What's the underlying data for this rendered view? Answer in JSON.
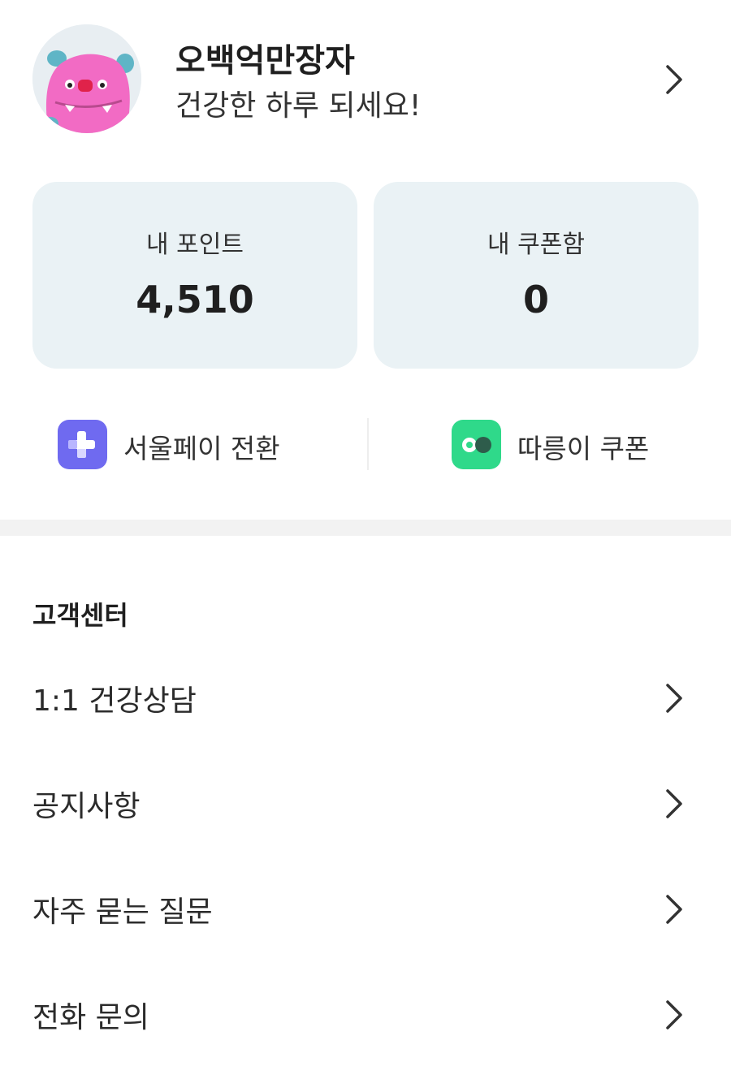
{
  "profile": {
    "nickname": "오백억만장자",
    "greeting": "건강한 하루 되세요!",
    "avatar_icon": "pink-monster-avatar"
  },
  "cards": {
    "points": {
      "label": "내 포인트",
      "value": "4,510"
    },
    "coupons": {
      "label": "내 쿠폰함",
      "value": "0"
    }
  },
  "quick_actions": [
    {
      "label": "서울페이 전환",
      "icon": "seoulpay-plus-icon",
      "color": "#6f6af0"
    },
    {
      "label": "따릉이 쿠폰",
      "icon": "ttareungi-bike-icon",
      "color": "#2fd98a"
    }
  ],
  "support": {
    "title": "고객센터",
    "items": [
      {
        "label": "1:1 건강상담"
      },
      {
        "label": "공지사항"
      },
      {
        "label": "자주 묻는 질문"
      },
      {
        "label": "전화 문의"
      }
    ]
  }
}
